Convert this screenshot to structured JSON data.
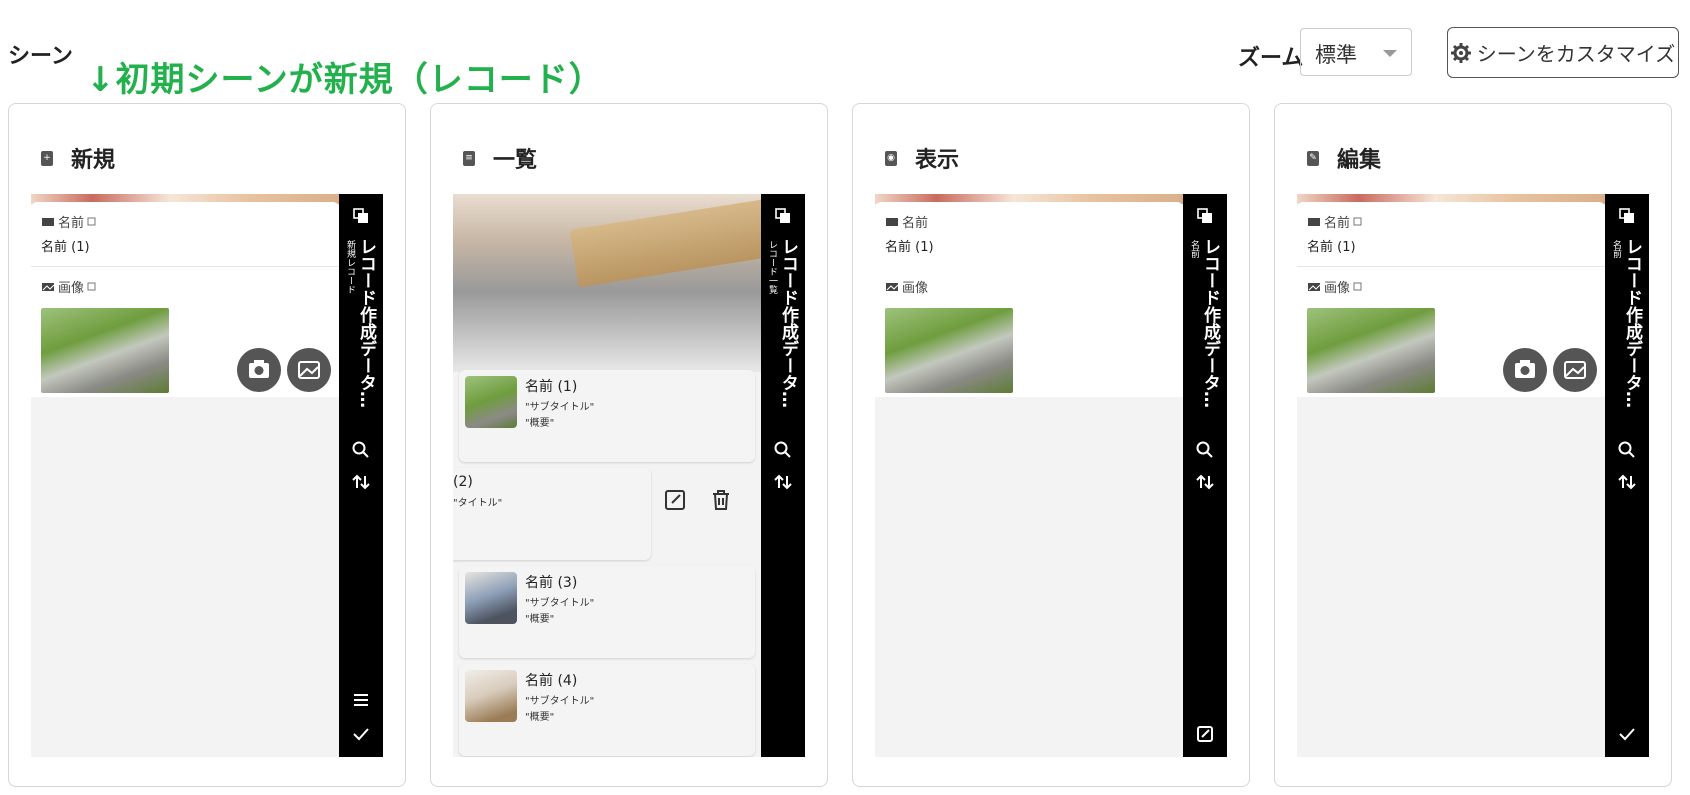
{
  "header": {
    "scene_title": "シーン",
    "annotation": "↓初期シーンが新規（レコード）",
    "zoom_label": "ズーム",
    "zoom_value": "標準",
    "customize_label": "シーンをカスタマイズ"
  },
  "cards": [
    {
      "title": "新規",
      "icon": "plus-doc-icon",
      "sidebar_title": "レコード作成データ…",
      "sidebar_sub": "新規レコード",
      "fields": [
        {
          "label": "名前",
          "value": "名前 (1)"
        },
        {
          "label": "画像"
        }
      ],
      "bottom_icons": [
        "menu-icon",
        "check-icon"
      ]
    },
    {
      "title": "一覧",
      "icon": "list-doc-icon",
      "sidebar_title": "レコード作成データ…",
      "sidebar_sub": "レコード一覧",
      "items": [
        {
          "name": "名前 (1)",
          "subtitle": "\"サブタイトル\"",
          "summary": "\"概要\""
        },
        {
          "name": "(2)",
          "subtitle": "\"タイトル\""
        },
        {
          "name": "名前 (3)",
          "subtitle": "\"サブタイトル\"",
          "summary": "\"概要\""
        },
        {
          "name": "名前 (4)",
          "subtitle": "\"サブタイトル\"",
          "summary": "\"概要\""
        }
      ]
    },
    {
      "title": "表示",
      "icon": "eye-doc-icon",
      "sidebar_title": "レコード作成データ…",
      "sidebar_sub": "名前",
      "fields": [
        {
          "label": "名前",
          "value": "名前 (1)"
        },
        {
          "label": "画像"
        }
      ],
      "bottom_icons": [
        "edit-icon"
      ]
    },
    {
      "title": "編集",
      "icon": "pencil-doc-icon",
      "sidebar_title": "レコード作成データ…",
      "sidebar_sub": "名前",
      "fields": [
        {
          "label": "名前",
          "value": "名前 (1)"
        },
        {
          "label": "画像"
        }
      ],
      "bottom_icons": [
        "check-icon"
      ]
    }
  ],
  "colors": {
    "annotation": "#22b14c",
    "sidebar": "#000000",
    "phone_bg": "#f3f3f3"
  }
}
